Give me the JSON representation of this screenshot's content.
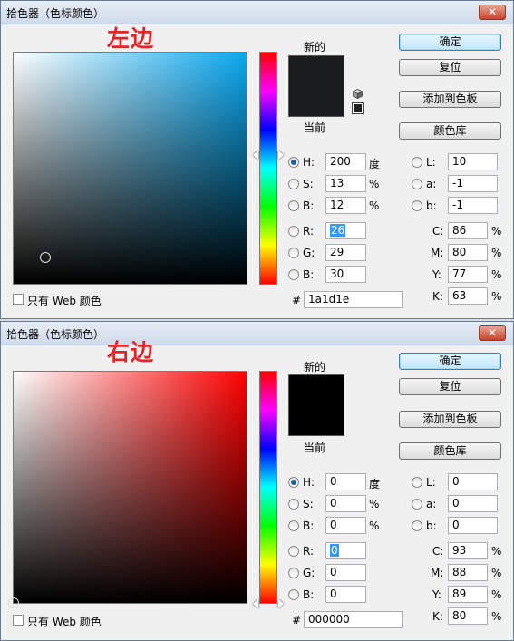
{
  "dialogs": [
    {
      "title": "拾色器（色标颜色）",
      "close_label": "✕",
      "annotation": "左边",
      "swatch_new_label": "新的",
      "swatch_current_label": "当前",
      "new_color": "#1a1d1e",
      "current_color": "#1a1d1e",
      "field_color": "#0aa8ee",
      "buttons": {
        "ok": "确定",
        "reset": "复位",
        "add": "添加到色板",
        "library": "颜色库"
      },
      "hsb": [
        {
          "label": "H:",
          "value": "200",
          "unit": "度",
          "checked": true
        },
        {
          "label": "S:",
          "value": "13",
          "unit": "%",
          "checked": false
        },
        {
          "label": "B:",
          "value": "12",
          "unit": "%",
          "checked": false
        }
      ],
      "rgb": [
        {
          "label": "R:",
          "value": "26",
          "selected": true
        },
        {
          "label": "G:",
          "value": "29"
        },
        {
          "label": "B:",
          "value": "30"
        }
      ],
      "lab": [
        {
          "label": "L:",
          "value": "10"
        },
        {
          "label": "a:",
          "value": "-1"
        },
        {
          "label": "b:",
          "value": "-1"
        }
      ],
      "cmyk": [
        {
          "label": "C:",
          "value": "86",
          "unit": "%"
        },
        {
          "label": "M:",
          "value": "80",
          "unit": "%"
        },
        {
          "label": "Y:",
          "value": "77",
          "unit": "%"
        },
        {
          "label": "K:",
          "value": "63",
          "unit": "%"
        }
      ],
      "hex_label": "#",
      "hex": "1a1d1e",
      "web_only_label": "只有 Web 颜色"
    },
    {
      "title": "拾色器（色标颜色）",
      "close_label": "✕",
      "annotation": "右边",
      "swatch_new_label": "新的",
      "swatch_current_label": "当前",
      "new_color": "#000000",
      "current_color": "#000000",
      "field_color": "#ff0000",
      "buttons": {
        "ok": "确定",
        "reset": "复位",
        "add": "添加到色板",
        "library": "颜色库"
      },
      "hsb": [
        {
          "label": "H:",
          "value": "0",
          "unit": "度",
          "checked": true
        },
        {
          "label": "S:",
          "value": "0",
          "unit": "%",
          "checked": false
        },
        {
          "label": "B:",
          "value": "0",
          "unit": "%",
          "checked": false
        }
      ],
      "rgb": [
        {
          "label": "R:",
          "value": "0",
          "selected": true
        },
        {
          "label": "G:",
          "value": "0"
        },
        {
          "label": "B:",
          "value": "0"
        }
      ],
      "lab": [
        {
          "label": "L:",
          "value": "0"
        },
        {
          "label": "a:",
          "value": "0"
        },
        {
          "label": "b:",
          "value": "0"
        }
      ],
      "cmyk": [
        {
          "label": "C:",
          "value": "93",
          "unit": "%"
        },
        {
          "label": "M:",
          "value": "88",
          "unit": "%"
        },
        {
          "label": "Y:",
          "value": "89",
          "unit": "%"
        },
        {
          "label": "K:",
          "value": "80",
          "unit": "%"
        }
      ],
      "hex_label": "#",
      "hex": "000000",
      "web_only_label": "只有 Web 颜色"
    }
  ]
}
